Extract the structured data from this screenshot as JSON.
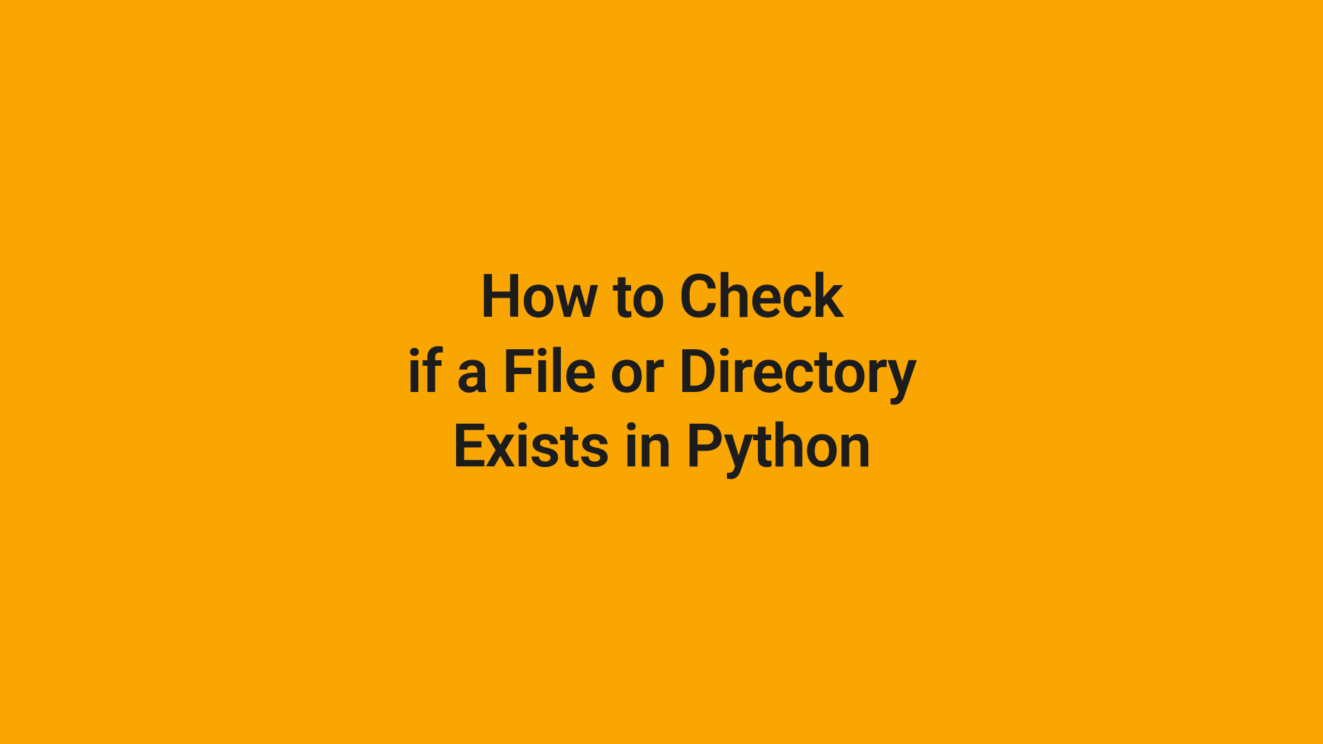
{
  "title": {
    "line1": "How to Check",
    "line2": "if a File or Directory",
    "line3": "Exists in Python"
  },
  "colors": {
    "background": "#F9A602",
    "text": "#1c1c1c"
  }
}
